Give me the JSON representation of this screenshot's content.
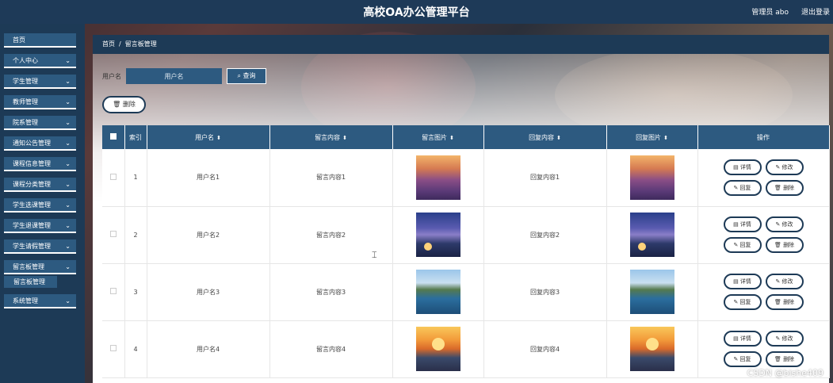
{
  "header": {
    "title": "高校OA办公管理平台",
    "user": "管理员 abo",
    "logout": "退出登录"
  },
  "sidebar": {
    "items": [
      {
        "label": "首页",
        "has_chevron": false
      },
      {
        "label": "个人中心"
      },
      {
        "label": "学生管理"
      },
      {
        "label": "教师管理"
      },
      {
        "label": "院系管理"
      },
      {
        "label": "通知公告管理"
      },
      {
        "label": "课程信息管理"
      },
      {
        "label": "课程分类管理"
      },
      {
        "label": "学生选课管理"
      },
      {
        "label": "学生退课管理"
      },
      {
        "label": "学生请假管理"
      },
      {
        "label": "留言板管理"
      },
      {
        "label": "系统管理"
      }
    ],
    "submenu_active": "留言板管理"
  },
  "breadcrumb": {
    "home": "首页",
    "separator": "/",
    "current": "留言板管理"
  },
  "search": {
    "label": "用户名",
    "placeholder": "用户名",
    "button": "查询"
  },
  "toolbar": {
    "delete_label": "删除"
  },
  "table": {
    "headers": [
      "索引",
      "用户名",
      "留言内容",
      "留言图片",
      "回复内容",
      "回复图片",
      "操作"
    ],
    "rows": [
      {
        "index": "1",
        "username": "用户名1",
        "content": "留言内容1",
        "image": "lav",
        "reply": "回复内容1",
        "reply_image": "lav"
      },
      {
        "index": "2",
        "username": "用户名2",
        "content": "留言内容2",
        "image": "dusk",
        "reply": "回复内容2",
        "reply_image": "dusk"
      },
      {
        "index": "3",
        "username": "用户名3",
        "content": "留言内容3",
        "image": "lake",
        "reply": "回复内容3",
        "reply_image": "lake"
      },
      {
        "index": "4",
        "username": "用户名4",
        "content": "留言内容4",
        "image": "sunset",
        "reply": "回复内容4",
        "reply_image": "sunset"
      }
    ],
    "row_actions": {
      "detail": "详情",
      "edit": "修改",
      "reply": "回复",
      "delete": "删除"
    }
  },
  "watermark": "CSDN @bishe409"
}
